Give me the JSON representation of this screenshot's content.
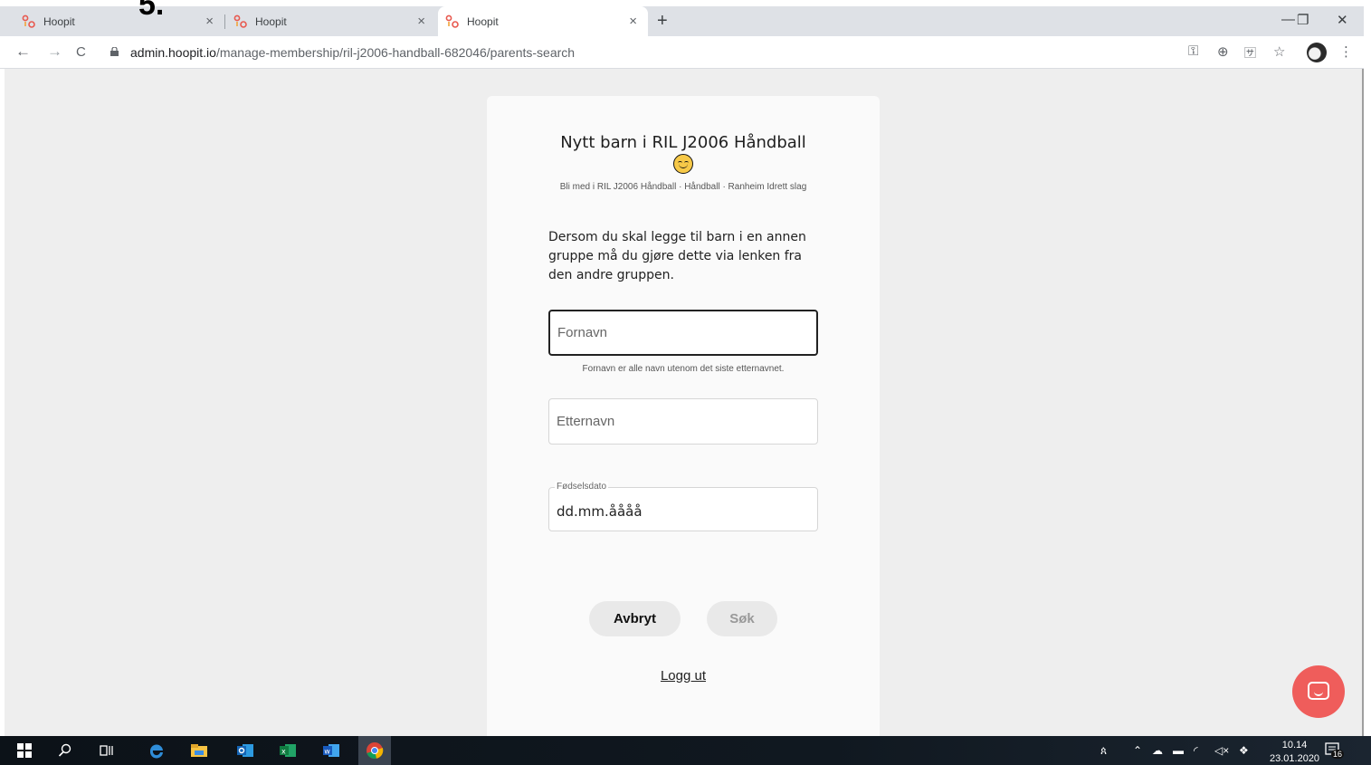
{
  "annotation": "5.",
  "browser": {
    "tabs": [
      {
        "title": "Hoopit",
        "close": "×"
      },
      {
        "title": "Hoopit",
        "close": "×"
      },
      {
        "title": "Hoopit",
        "close": "×"
      }
    ],
    "new_tab": "+",
    "window_controls": {
      "minimize": "—",
      "restore": "❐",
      "close": "✕"
    },
    "nav": {
      "back": "←",
      "forward": "→",
      "reload": "C"
    },
    "url_host": "admin.hoopit.io",
    "url_path": "/manage-membership/ril-j2006-handball-682046/parents-search",
    "toolbar_icons": {
      "key": "⚿",
      "zoom": "⊕",
      "translate": "🈂",
      "star": "☆",
      "menu": "⋮"
    }
  },
  "page": {
    "title": "Nytt barn i RIL J2006 Håndball",
    "subtitle": "Bli med i RIL J2006 Håndball · Håndball · Ranheim Idrett slag",
    "info": "Dersom du skal legge til barn i en annen gruppe må du gjøre dette via lenken fra den andre gruppen.",
    "fields": {
      "first_name_placeholder": "Fornavn",
      "first_name_helper": "Fornavn er alle navn utenom det siste etternavnet.",
      "last_name_placeholder": "Etternavn",
      "birthdate_label": "Fødselsdato",
      "birthdate_value": "dd.mm.åååå"
    },
    "buttons": {
      "cancel": "Avbryt",
      "search": "Søk"
    },
    "logout": "Logg ut"
  },
  "taskbar": {
    "time": "10.14",
    "date": "23.01.2020",
    "notifications": "16"
  },
  "colors": {
    "chat_button": "#ef5d5b",
    "page_bg": "#eeeeee",
    "card_bg": "#fafafa"
  }
}
